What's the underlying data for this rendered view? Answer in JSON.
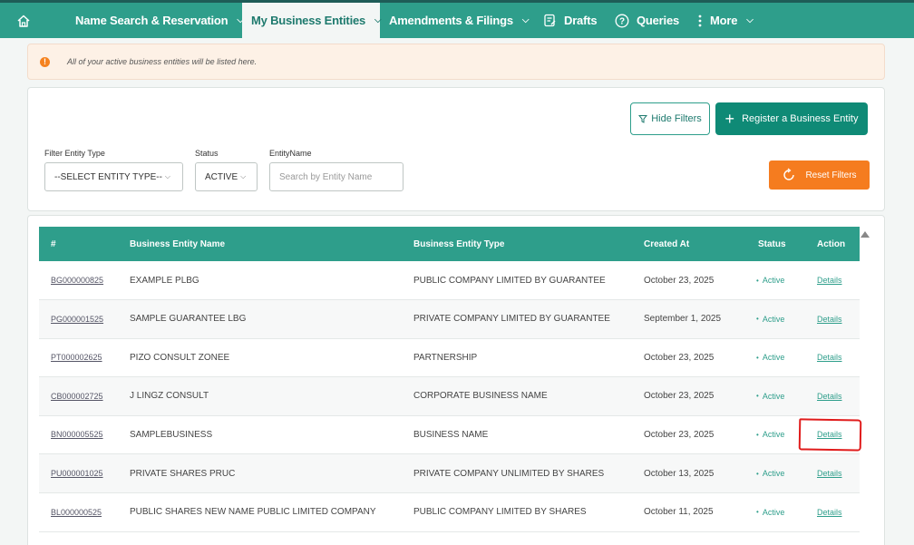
{
  "nav": {
    "items": [
      {
        "label": "",
        "icon": "home-icon"
      },
      {
        "label": "Name Search & Reservation"
      },
      {
        "label": "My Business Entities"
      },
      {
        "label": "Amendments & Filings"
      },
      {
        "label": "Drafts",
        "icon": "drafts-icon"
      },
      {
        "label": "Queries",
        "icon": "question-icon"
      },
      {
        "label": "More",
        "icon": "kebab-icon"
      }
    ],
    "active_index": 2
  },
  "banner": {
    "icon": "alert-icon",
    "text": "All of your active business entities will be listed here."
  },
  "filters": {
    "hide_filters_label": "Hide Filters",
    "register_label": "Register a Business Entity",
    "reset_label": "Reset Filters",
    "entity_type": {
      "label": "Filter Entity Type",
      "value": "--SELECT ENTITY TYPE--"
    },
    "status": {
      "label": "Status",
      "value": "ACTIVE"
    },
    "entity_name": {
      "label": "EntityName",
      "placeholder": "Search by Entity Name"
    }
  },
  "table": {
    "columns": [
      "#",
      "Business Entity Name",
      "Business Entity Type",
      "Created At",
      "Status",
      "Action"
    ],
    "rows": [
      {
        "id": "BG000000825",
        "name": "EXAMPLE PLBG",
        "type": "PUBLIC COMPANY LIMITED BY GUARANTEE",
        "created": "October 23, 2025",
        "status": "Active",
        "action": "Details"
      },
      {
        "id": "PG000001525",
        "name": "SAMPLE GUARANTEE LBG",
        "type": "PRIVATE COMPANY LIMITED BY GUARANTEE",
        "created": "September 1, 2025",
        "status": "Active",
        "action": "Details"
      },
      {
        "id": "PT000002625",
        "name": "PIZO CONSULT ZONEE",
        "type": "PARTNERSHIP",
        "created": "October 23, 2025",
        "status": "Active",
        "action": "Details"
      },
      {
        "id": "CB000002725",
        "name": "J LINGZ CONSULT",
        "type": "CORPORATE BUSINESS NAME",
        "created": "October 23, 2025",
        "status": "Active",
        "action": "Details"
      },
      {
        "id": "BN000005525",
        "name": "SAMPLEBUSINESS",
        "type": "BUSINESS NAME",
        "created": "October 23, 2025",
        "status": "Active",
        "action": "Details"
      },
      {
        "id": "PU000001025",
        "name": "PRIVATE SHARES PRUC",
        "type": "PRIVATE COMPANY UNLIMITED BY SHARES",
        "created": "October 13, 2025",
        "status": "Active",
        "action": "Details"
      },
      {
        "id": "BL000000525",
        "name": "PUBLIC SHARES NEW NAME PUBLIC LIMITED COMPANY",
        "type": "PUBLIC COMPANY LIMITED BY SHARES",
        "created": "October 11, 2025",
        "status": "Active",
        "action": "Details"
      }
    ]
  },
  "colors": {
    "brand": "#2e9e8b",
    "accent": "#f57c1f",
    "annotation": "#e01b1b"
  }
}
